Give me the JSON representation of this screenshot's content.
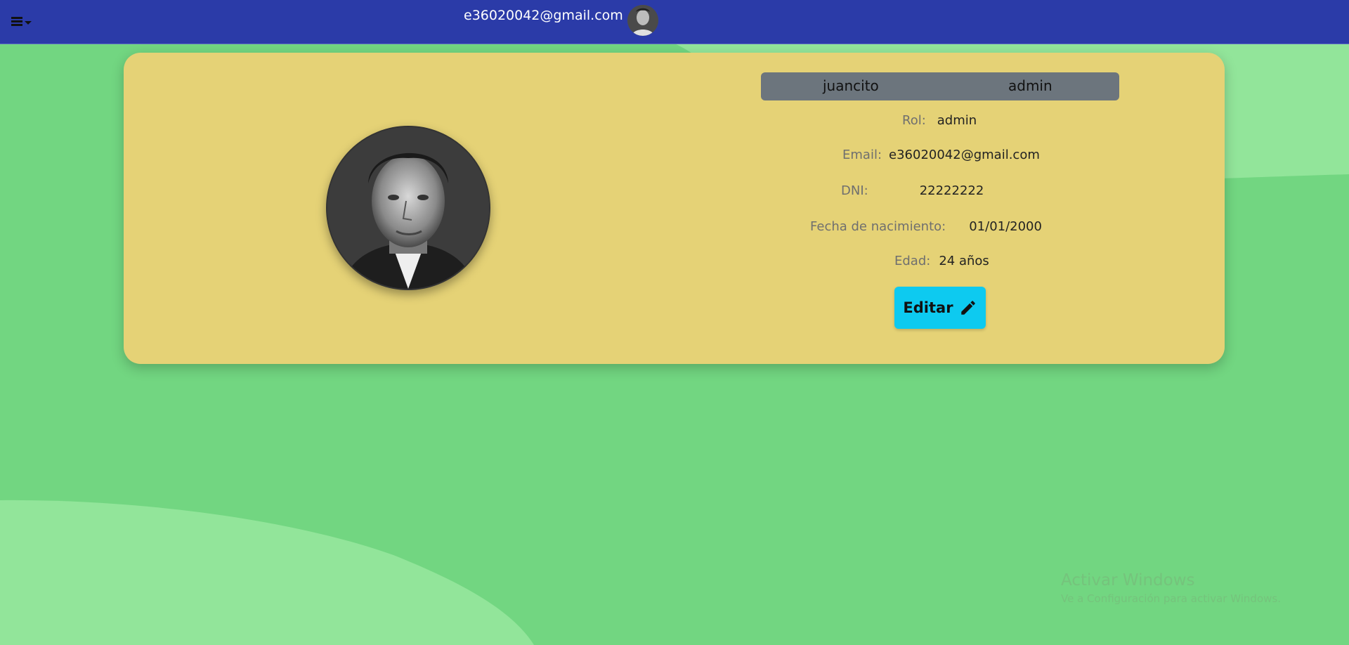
{
  "header": {
    "menu_icon": "menu-icon",
    "user_email": "e36020042@gmail.com",
    "avatar_icon": "user-avatar"
  },
  "profile": {
    "username": "juancito",
    "role_badge": "admin",
    "fields": [
      {
        "label": "Rol:",
        "value": "admin"
      },
      {
        "label": "Email:",
        "value": "e36020042@gmail.com"
      },
      {
        "label": "DNI:",
        "value": "22222222"
      },
      {
        "label": "Fecha de nacimiento:",
        "value": "01/01/2000"
      },
      {
        "label": "Edad:",
        "value": "24 años"
      }
    ],
    "edit_label": "Editar",
    "edit_icon": "pencil-icon"
  },
  "watermark": {
    "title": "Activar Windows",
    "subtitle": "Ve a Configuración para activar Windows."
  },
  "colors": {
    "navbar": "#2b3ba8",
    "background": "#72d681",
    "card": "#e5d276",
    "name_bar": "#6c757d",
    "edit_button": "#0dcaf0"
  }
}
